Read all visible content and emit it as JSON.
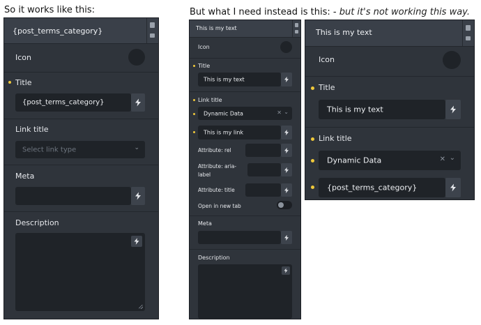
{
  "captions": {
    "left": "So it works like this:",
    "right_plain": "But what I need instead is this: -",
    "right_italic": "but it's not working this way."
  },
  "panel1": {
    "header_text": "{post_terms_category}",
    "icon_label": "Icon",
    "title_label": "Title",
    "title_value": "{post_terms_category}",
    "link_title_label": "Link title",
    "link_type_placeholder": "Select link type",
    "meta_label": "Meta",
    "description_label": "Description"
  },
  "panel2": {
    "header_text": "This is my text",
    "icon_label": "Icon",
    "title_label": "Title",
    "title_value": "This is my text",
    "link_title_label": "Link title",
    "link_type_value": "Dynamic Data",
    "link_value": "This is my link",
    "attr_rel_label": "Attribute: rel",
    "attr_aria_label_line1": "Attribute: aria-",
    "attr_aria_label_line2": "label",
    "attr_title_label": "Attribute: title",
    "new_tab_label": "Open in new tab",
    "meta_label": "Meta",
    "description_label": "Description"
  },
  "panel3": {
    "header_text": "This is my text",
    "icon_label": "Icon",
    "title_label": "Title",
    "title_value": "This is my text",
    "link_title_label": "Link title",
    "link_type_value": "Dynamic Data",
    "link_value": "{post_terms_category}"
  },
  "colors": {
    "panel_bg": "#2f343b",
    "input_bg": "#1f2328",
    "accent_dot": "#f0c93a"
  },
  "icons": {
    "dynamic": "lightning-bolt-icon",
    "copy": "copy-icon",
    "delete": "trash-icon",
    "clear": "clear-x-icon",
    "dropdown": "chevron-down-icon"
  }
}
